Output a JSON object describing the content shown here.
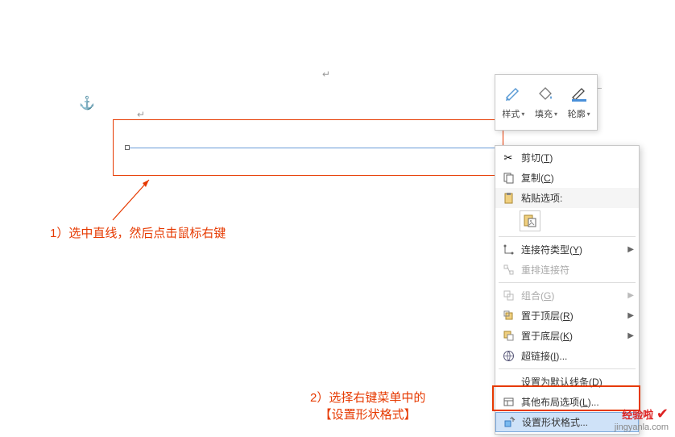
{
  "anchor": "⚓",
  "paragraph_mark": "↵",
  "toolbar": {
    "style": {
      "label": "样式"
    },
    "fill": {
      "label": "填充"
    },
    "outline": {
      "label": "轮廓"
    }
  },
  "menu": {
    "cut": {
      "label": "剪切",
      "accel": "T"
    },
    "copy": {
      "label": "复制",
      "accel": "C"
    },
    "paste_options": {
      "label": "粘贴选项:"
    },
    "connector_type": {
      "label": "连接符类型",
      "accel": "Y"
    },
    "rearrange_connectors": {
      "label": "重排连接符"
    },
    "group": {
      "label": "组合",
      "accel": "G"
    },
    "bring_to_front": {
      "label": "置于顶层",
      "accel": "R"
    },
    "send_to_back": {
      "label": "置于底层",
      "accel": "K"
    },
    "hyperlink": {
      "label": "超链接",
      "accel": "I",
      "suffix": "..."
    },
    "set_default_line": {
      "label": "设置为默认线条",
      "accel": "D"
    },
    "other_layout_options": {
      "label": "其他布局选项",
      "accel": "L"
    },
    "format_shape": {
      "label": "设置形状格式",
      "suffix": "..."
    }
  },
  "annotations": {
    "a1": "1）选中直线，然后点击鼠标右键",
    "a2_line1": "2）选择右键菜单中的",
    "a2_line2": "【设置形状格式】"
  },
  "watermark": {
    "title": "经验啦",
    "url": "jingyanla.com"
  }
}
